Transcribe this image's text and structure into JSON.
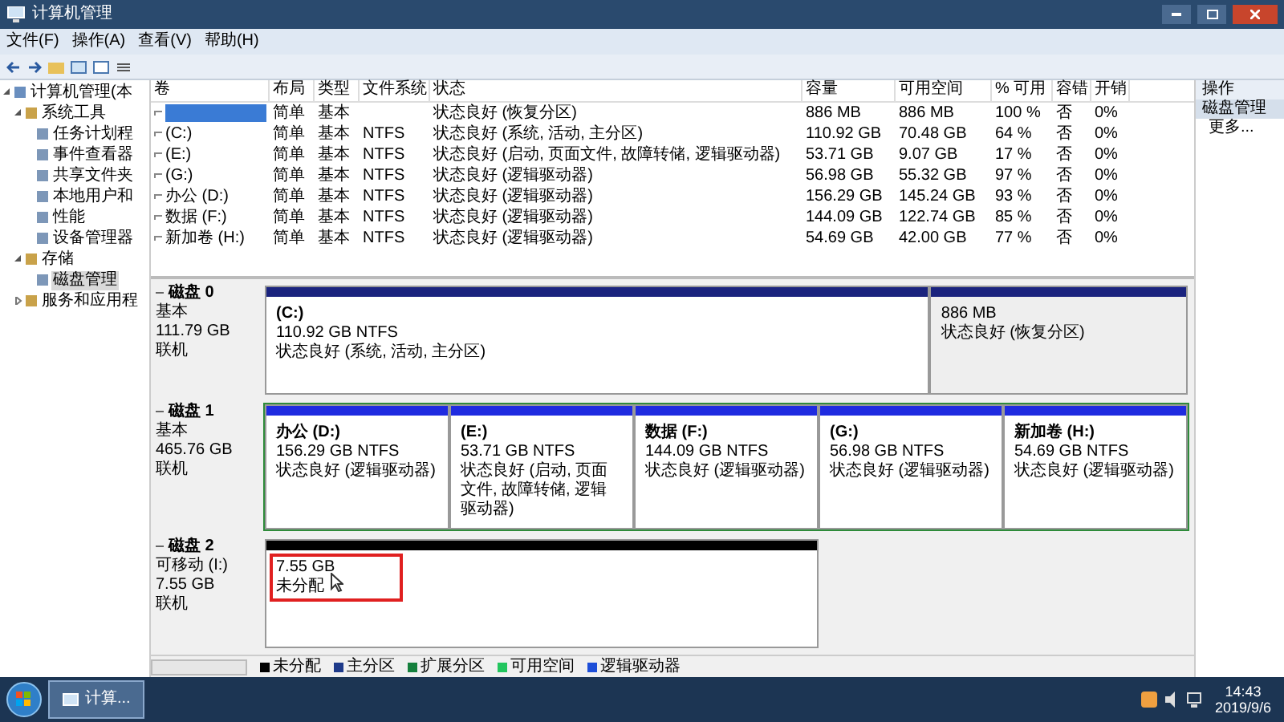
{
  "window": {
    "title": "计算机管理"
  },
  "menu": [
    "文件(F)",
    "操作(A)",
    "查看(V)",
    "帮助(H)"
  ],
  "tree": [
    {
      "label": "计算机管理(本",
      "expanded": true,
      "selected": false,
      "children": [
        {
          "label": "系统工具",
          "expanded": true,
          "selected": false,
          "children": [
            {
              "label": "任务计划程",
              "selected": false
            },
            {
              "label": "事件查看器",
              "selected": false
            },
            {
              "label": "共享文件夹",
              "selected": false
            },
            {
              "label": "本地用户和",
              "selected": false
            },
            {
              "label": "性能",
              "selected": false
            },
            {
              "label": "设备管理器",
              "selected": false
            }
          ]
        },
        {
          "label": "存储",
          "expanded": true,
          "selected": false,
          "children": [
            {
              "label": "磁盘管理",
              "selected": true
            }
          ]
        },
        {
          "label": "服务和应用程",
          "expanded": false,
          "selected": false
        }
      ]
    }
  ],
  "table": {
    "columns": [
      "卷",
      "布局",
      "类型",
      "文件系统",
      "状态",
      "容量",
      "可用空间",
      "% 可用",
      "容错",
      "开销"
    ],
    "rows": [
      {
        "selected": true,
        "layout": "简单",
        "type": "基本",
        "status": "状态良好 (恢复分区)",
        "capacity": "886 MB",
        "free": "886 MB",
        "pct_free": "100 %",
        "fault_tolerance": "否",
        "overhead": "0%"
      },
      {
        "selected": false,
        "volume": "(C:)",
        "layout": "简单",
        "type": "基本",
        "filesystem": "NTFS",
        "status": "状态良好 (系统, 活动, 主分区)",
        "capacity": "110.92 GB",
        "free": "70.48 GB",
        "pct_free": "64 %",
        "fault_tolerance": "否",
        "overhead": "0%"
      },
      {
        "selected": false,
        "volume": "(E:)",
        "layout": "简单",
        "type": "基本",
        "filesystem": "NTFS",
        "status": "状态良好 (启动, 页面文件, 故障转储, 逻辑驱动器)",
        "capacity": "53.71 GB",
        "free": "9.07 GB",
        "pct_free": "17 %",
        "fault_tolerance": "否",
        "overhead": "0%"
      },
      {
        "selected": false,
        "volume": "(G:)",
        "layout": "简单",
        "type": "基本",
        "filesystem": "NTFS",
        "status": "状态良好 (逻辑驱动器)",
        "capacity": "56.98 GB",
        "free": "55.32 GB",
        "pct_free": "97 %",
        "fault_tolerance": "否",
        "overhead": "0%"
      },
      {
        "selected": false,
        "volume": "办公 (D:)",
        "layout": "简单",
        "type": "基本",
        "filesystem": "NTFS",
        "status": "状态良好 (逻辑驱动器)",
        "capacity": "156.29 GB",
        "free": "145.24 GB",
        "pct_free": "93 %",
        "fault_tolerance": "否",
        "overhead": "0%"
      },
      {
        "selected": false,
        "volume": "数据 (F:)",
        "layout": "简单",
        "type": "基本",
        "filesystem": "NTFS",
        "status": "状态良好 (逻辑驱动器)",
        "capacity": "144.09 GB",
        "free": "122.74 GB",
        "pct_free": "85 %",
        "fault_tolerance": "否",
        "overhead": "0%"
      },
      {
        "selected": false,
        "volume": "新加卷 (H:)",
        "layout": "简单",
        "type": "基本",
        "filesystem": "NTFS",
        "status": "状态良好 (逻辑驱动器)",
        "capacity": "54.69 GB",
        "free": "42.00 GB",
        "pct_free": "77 %",
        "fault_tolerance": "否",
        "overhead": "0%"
      }
    ]
  },
  "disks": [
    {
      "name": "磁盘 0",
      "type": "基本",
      "size": "111.79 GB",
      "state": "联机",
      "partitions": [
        {
          "kind": "primary",
          "highlighted": false,
          "name": "(C:)",
          "size": "110.92 GB NTFS",
          "status": "状态良好 (系统, 活动, 主分区)"
        },
        {
          "kind": "recovery",
          "highlighted": false,
          "size": "886 MB",
          "status": "状态良好 (恢复分区)"
        }
      ]
    },
    {
      "name": "磁盘 1",
      "type": "基本",
      "size": "465.76 GB",
      "state": "联机",
      "extended": true,
      "partitions": [
        {
          "kind": "logical",
          "highlighted": false,
          "name": "办公 (D:)",
          "size": "156.29 GB NTFS",
          "status": "状态良好 (逻辑驱动器)"
        },
        {
          "kind": "logical",
          "highlighted": false,
          "name": "(E:)",
          "size": "53.71 GB NTFS",
          "status": "状态良好 (启动, 页面文件, 故障转储, 逻辑驱动器)"
        },
        {
          "kind": "logical",
          "highlighted": false,
          "name": "数据 (F:)",
          "size": "144.09 GB NTFS",
          "status": "状态良好 (逻辑驱动器)"
        },
        {
          "kind": "logical",
          "highlighted": false,
          "name": "(G:)",
          "size": "56.98 GB NTFS",
          "status": "状态良好 (逻辑驱动器)"
        },
        {
          "kind": "logical",
          "highlighted": false,
          "name": "新加卷 (H:)",
          "size": "54.69 GB NTFS",
          "status": "状态良好 (逻辑驱动器)"
        }
      ]
    },
    {
      "name": "磁盘 2",
      "type": "可移动 (I:)",
      "size": "7.55 GB",
      "state": "联机",
      "partitions": [
        {
          "kind": "unallocated",
          "highlighted": true,
          "size": "7.55 GB",
          "status": "未分配"
        }
      ]
    }
  ],
  "legend": [
    {
      "label": "未分配",
      "color": "#000000"
    },
    {
      "label": "主分区",
      "color": "#1e3a8a"
    },
    {
      "label": "扩展分区",
      "color": "#15803d"
    },
    {
      "label": "可用空间",
      "color": "#22c55e"
    },
    {
      "label": "逻辑驱动器",
      "color": "#1d4ed8"
    }
  ],
  "actions": {
    "title": "操作",
    "section": "磁盘管理",
    "items": [
      "更多..."
    ]
  },
  "taskbar": {
    "tasks": [
      {
        "label": "计算...",
        "selected": true
      }
    ],
    "time": "14:43",
    "date": "2019/9/6"
  }
}
